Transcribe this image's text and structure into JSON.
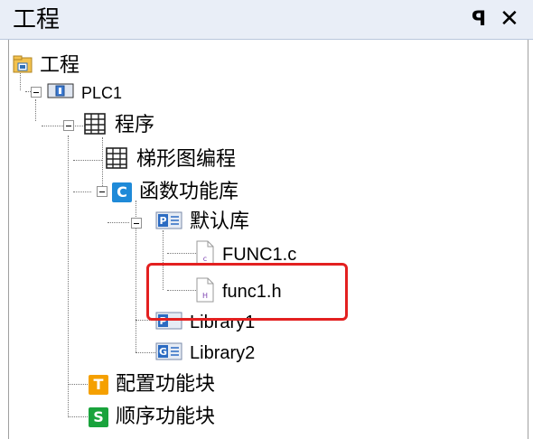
{
  "panel": {
    "title": "工程",
    "pin_glyph": "ꟼ",
    "close_glyph": "✕"
  },
  "tree": {
    "root": "工程",
    "plc": "PLC1",
    "program": "程序",
    "ladder": "梯形图编程",
    "func_lib": "函数功能库",
    "default_lib": "默认库",
    "func1_c": "FUNC1.c",
    "func1_h": "func1.h",
    "library1": "Library1",
    "library2": "Library2",
    "config_block": "配置功能块",
    "seq_block": "顺序功能块"
  },
  "icons": {
    "func_lib": {
      "name": "c-badge-icon",
      "letter": "C",
      "color": "#1f8ad8"
    },
    "config_block": {
      "name": "t-badge-icon",
      "letter": "T",
      "color": "#f5a000"
    },
    "seq_block": {
      "name": "s-badge-icon",
      "letter": "S",
      "color": "#19a33c"
    },
    "c_file_letter": "c",
    "h_file_letter": "H",
    "p_lib_letter": "P",
    "g_lib_letter": "G"
  },
  "annotation_color": "#e32020"
}
